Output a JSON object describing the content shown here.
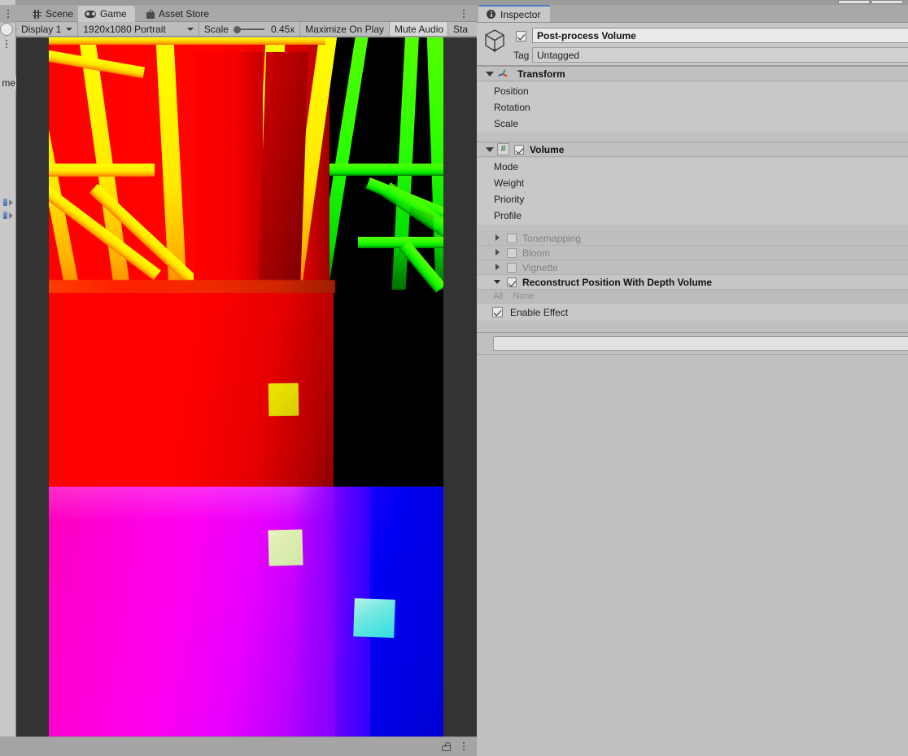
{
  "window": {
    "top_strip_fields": 2
  },
  "hierarchy": {
    "partial_label": "me",
    "rows": [
      "",
      ""
    ]
  },
  "game_view": {
    "tabs": [
      {
        "label": "Scene",
        "icon": "grid-icon",
        "active": false
      },
      {
        "label": "Game",
        "icon": "gamepad-icon",
        "active": true
      },
      {
        "label": "Asset Store",
        "icon": "store-icon",
        "active": false
      }
    ],
    "toolbar": {
      "display": "Display 1",
      "resolution": "1920x1080 Portrait",
      "scale_label": "Scale",
      "scale_value": "0.45x",
      "maximize_on_play": "Maximize On Play",
      "mute_audio": "Mute Audio",
      "stats": "Sta"
    },
    "footer": {
      "lock_icon": "lock-icon",
      "menu_icon": "kebab-menu-icon"
    },
    "render": {
      "description": "Reconstructed world-position debug render: red/yellow ceiling beams, black void, magenta-blue floor gradient, three floating cubes",
      "background_color": "#333333",
      "cubes": [
        {
          "name": "cube-yellow",
          "color": "#e4dc00"
        },
        {
          "name": "cube-pale",
          "color": "#dcecb0"
        },
        {
          "name": "cube-cyan",
          "color": "#6fe8e0"
        }
      ]
    }
  },
  "inspector": {
    "tab_label": "Inspector",
    "object": {
      "name": "Post-process Volume",
      "enabled": true,
      "tag_label": "Tag",
      "tag_value": "Untagged"
    },
    "components": [
      {
        "title": "Transform",
        "icon": "transform-icon",
        "expanded": true,
        "properties": [
          "Position",
          "Rotation",
          "Scale"
        ]
      },
      {
        "title": "Volume",
        "icon": "script-icon",
        "script_glyph": "#",
        "enabled": true,
        "expanded": true,
        "properties": [
          "Mode",
          "Weight",
          "Priority",
          "Profile"
        ]
      }
    ],
    "effects": [
      {
        "label": "Tonemapping",
        "checked": false,
        "expanded": false
      },
      {
        "label": "Bloom",
        "checked": false,
        "expanded": false
      },
      {
        "label": "Vignette",
        "checked": false,
        "expanded": false
      },
      {
        "label": "Reconstruct Position With Depth Volume",
        "checked": true,
        "expanded": true
      }
    ],
    "all_none": {
      "all": "All",
      "none": "None"
    },
    "enable_effect": {
      "label": "Enable Effect",
      "checked": true
    },
    "add_field_value": ""
  },
  "colors": {
    "panel_bg": "#c0c0c0",
    "panel_alt": "#c8c8c8",
    "tabbar_bg": "#a8a8a8",
    "accent_tab": "#4a78c8",
    "game_bg": "#333333"
  }
}
